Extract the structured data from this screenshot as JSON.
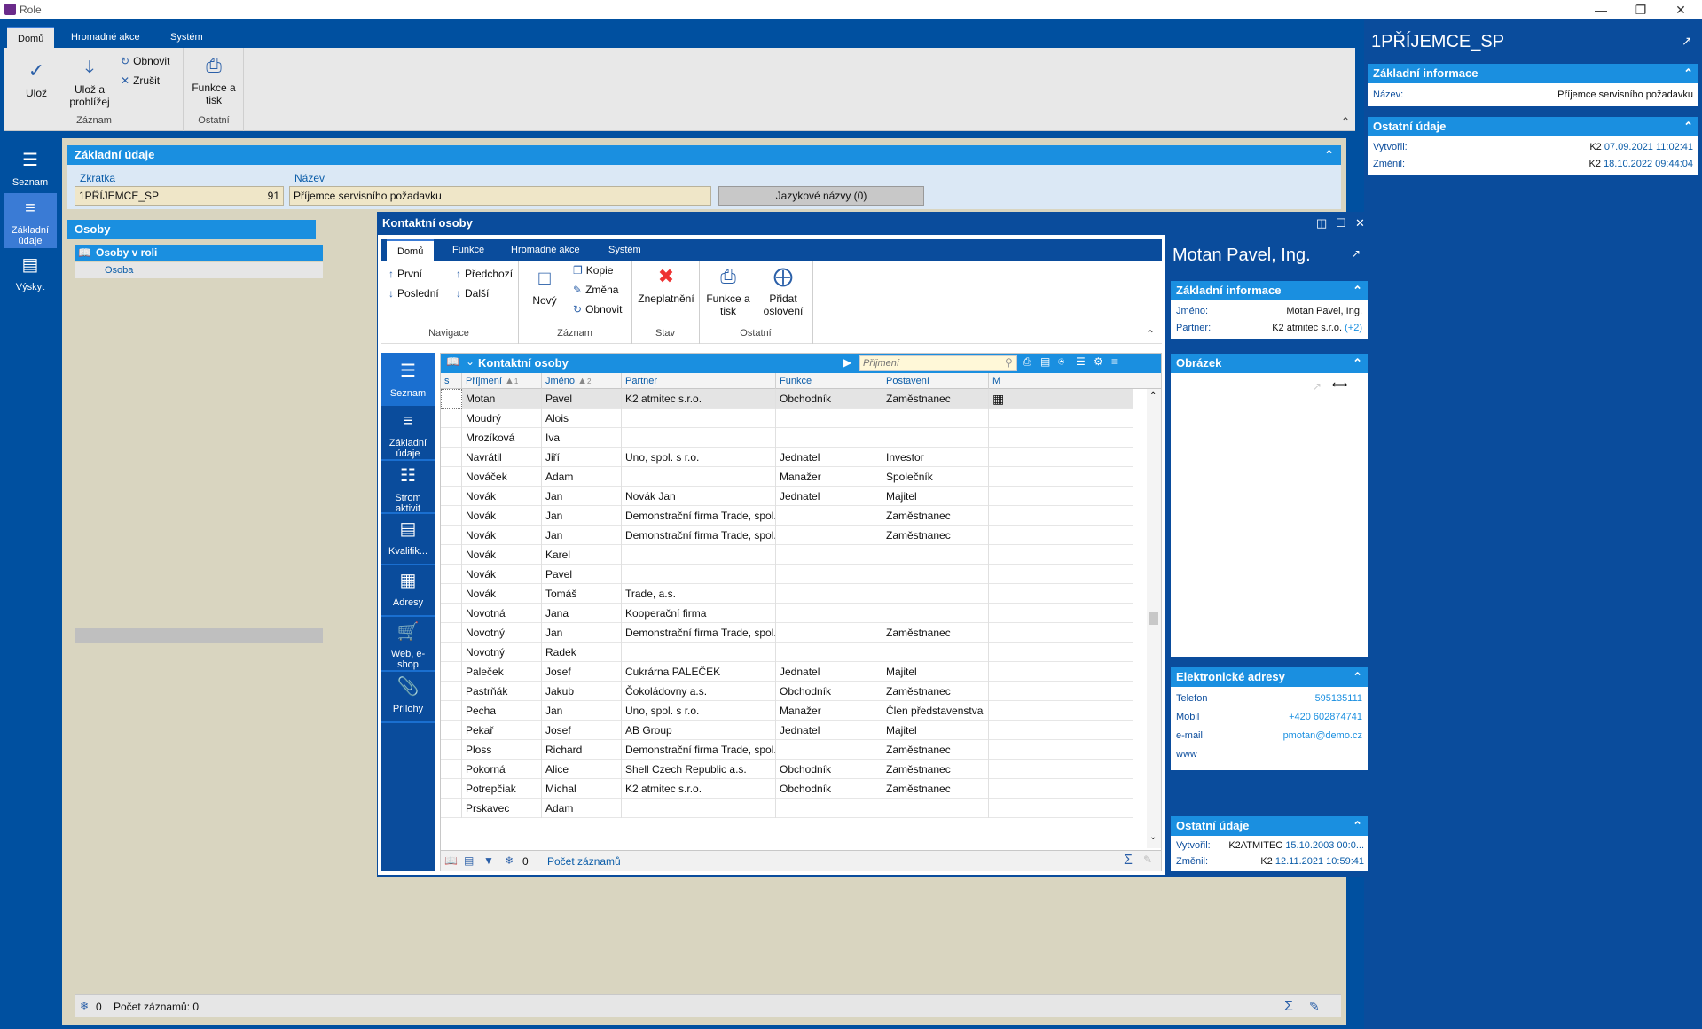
{
  "window": {
    "title": "Role"
  },
  "ribbon": {
    "tabs": [
      "Domů",
      "Hromadné akce",
      "Systém"
    ],
    "buttons": {
      "save": "Ulož",
      "save_view": "Ulož a prohlížej",
      "refresh": "Obnovit",
      "cancel": "Zrušit",
      "print": "Funkce a tisk"
    },
    "groups": {
      "record": "Záznam",
      "other": "Ostatní"
    }
  },
  "leftnav": [
    "Seznam",
    "Základní údaje",
    "Výskyt"
  ],
  "main": {
    "section_basic": "Základní údaje",
    "label_abbr": "Zkratka",
    "abbr": "1PŘÍJEMCE_SP",
    "abbr_num": "91",
    "label_name": "Název",
    "name": "Příjemce servisního požadavku",
    "lang_button": "Jazykové názvy (0)",
    "section_persons": "Osoby",
    "subsection_persons": "Osoby v roli",
    "col_person": "Osoba",
    "footer_count": "0",
    "footer_records": "Počet záznamů: 0"
  },
  "right_panel": {
    "title": "1PŘÍJEMCE_SP",
    "sec_basic": "Základní informace",
    "label_name": "Název:",
    "name": "Příjemce servisního požadavku",
    "sec_other": "Ostatní údaje",
    "label_created": "Vytvořil:",
    "created_user": "K2",
    "created_date": "07.09.2021 11:02:41",
    "label_changed": "Změnil:",
    "changed_user": "K2",
    "changed_date": "18.10.2022 09:44:04"
  },
  "dialog": {
    "title": "Kontaktní osoby",
    "tabs": [
      "Domů",
      "Funkce",
      "Hromadné akce",
      "Systém"
    ],
    "nav": {
      "first": "První",
      "prev": "Předchozí",
      "last": "Poslední",
      "next": "Další",
      "group": "Navigace"
    },
    "record": {
      "new": "Nový",
      "copy": "Kopie",
      "change": "Změna",
      "refresh": "Obnovit",
      "group": "Záznam"
    },
    "state": {
      "invalidate": "Zneplatnění",
      "group": "Stav"
    },
    "other": {
      "print": "Funkce a tisk",
      "add_salutation": "Přidat oslovení",
      "group": "Ostatní"
    },
    "leftnav": [
      "Seznam",
      "Základní údaje",
      "Strom aktivit",
      "Kvalifik...",
      "Adresy",
      "Web, e-shop",
      "Přílohy"
    ],
    "grid": {
      "title": "Kontaktní osoby",
      "search_placeholder": "Příjmení",
      "columns": [
        "s",
        "Příjmení",
        "Jméno",
        "Partner",
        "Funkce",
        "Postavení",
        "M"
      ],
      "sort_marks": [
        "1",
        "2"
      ],
      "rows": [
        [
          "Motan",
          "Pavel",
          "K2 atmitec s.r.o.",
          "Obchodník",
          "Zaměstnanec"
        ],
        [
          "Moudrý",
          "Alois",
          "",
          "",
          ""
        ],
        [
          "Mrozíková",
          "Iva",
          "",
          "",
          ""
        ],
        [
          "Navrátil",
          "Jiří",
          "Uno, spol. s r.o.",
          "Jednatel",
          "Investor"
        ],
        [
          "Nováček",
          "Adam",
          "",
          "Manažer",
          "Společník"
        ],
        [
          "Novák",
          "Jan",
          "Novák Jan",
          "Jednatel",
          "Majitel"
        ],
        [
          "Novák",
          "Jan",
          "Demonstrační firma Trade, spol. ...",
          "",
          "Zaměstnanec"
        ],
        [
          "Novák",
          "Jan",
          "Demonstrační firma Trade, spol. ...",
          "",
          "Zaměstnanec"
        ],
        [
          "Novák",
          "Karel",
          "",
          "",
          ""
        ],
        [
          "Novák",
          "Pavel",
          "",
          "",
          ""
        ],
        [
          "Novák",
          "Tomáš",
          "Trade, a.s.",
          "",
          ""
        ],
        [
          "Novotná",
          "Jana",
          "Kooperační firma",
          "",
          ""
        ],
        [
          "Novotný",
          "Jan",
          "Demonstrační firma Trade, spol. ...",
          "",
          "Zaměstnanec"
        ],
        [
          "Novotný",
          "Radek",
          "",
          "",
          ""
        ],
        [
          "Paleček",
          "Josef",
          "Cukrárna PALEČEK",
          "Jednatel",
          "Majitel"
        ],
        [
          "Pastrňák",
          "Jakub",
          "Čokoládovny a.s.",
          "Obchodník",
          "Zaměstnanec"
        ],
        [
          "Pecha",
          "Jan",
          "Uno, spol. s r.o.",
          "Manažer",
          "Člen představenstva"
        ],
        [
          "Pekař",
          "Josef",
          "AB Group",
          "Jednatel",
          "Majitel"
        ],
        [
          "Ploss",
          "Richard",
          "Demonstrační firma Trade, spol. ...",
          "",
          "Zaměstnanec"
        ],
        [
          "Pokorná",
          "Alice",
          "Shell Czech Republic a.s.",
          "Obchodník",
          "Zaměstnanec"
        ],
        [
          "Potrepčiak",
          "Michal",
          "K2 atmitec s.r.o.",
          "Obchodník",
          "Zaměstnanec"
        ],
        [
          "Prskavec",
          "Adam",
          "",
          "",
          ""
        ]
      ],
      "footer_count": "0",
      "footer_records": "Počet záznamů"
    },
    "detail": {
      "title": "Motan Pavel, Ing.",
      "sec_basic": "Základní informace",
      "label_name": "Jméno:",
      "name": "Motan Pavel, Ing.",
      "label_partner": "Partner:",
      "partner": "K2 atmitec s.r.o.",
      "partner_more": "(+2)",
      "sec_image": "Obrázek",
      "sec_electronic": "Elektronické adresy",
      "label_phone": "Telefon",
      "phone": "595135111",
      "label_mobile": "Mobil",
      "mobile": "+420 602874741",
      "label_email": "e-mail",
      "email": "pmotan@demo.cz",
      "label_www": "www",
      "sec_other": "Ostatní údaje",
      "label_created": "Vytvořil:",
      "created_user": "K2ATMITEC",
      "created_date": "15.10.2003 00:0...",
      "label_changed": "Změnil:",
      "changed_user": "K2",
      "changed_date": "12.11.2021 10:59:41"
    }
  }
}
